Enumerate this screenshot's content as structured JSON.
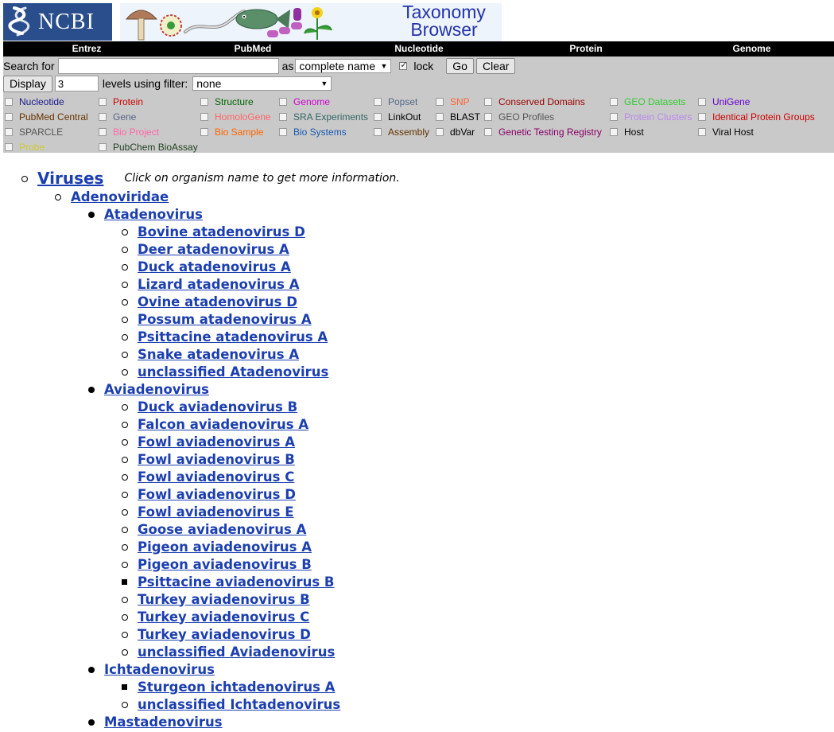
{
  "header": {
    "logo_text": "NCBI",
    "banner_title_line1": "Taxonomy",
    "banner_title_line2": "Browser"
  },
  "nav": [
    "Entrez",
    "PubMed",
    "Nucleotide",
    "Protein",
    "Genome"
  ],
  "search": {
    "label": "Search for",
    "value": "",
    "as_label": "as",
    "name_type": "complete name",
    "lock_label": "lock",
    "lock_checked": true,
    "go_label": "Go",
    "clear_label": "Clear"
  },
  "display": {
    "button_label": "Display",
    "levels_value": "3",
    "levels_label": "levels using filter:",
    "filter_value": "none"
  },
  "filters": [
    {
      "label": "Nucleotide",
      "color": "#1a1a8c"
    },
    {
      "label": "Protein",
      "color": "#cc0000"
    },
    {
      "label": "Structure",
      "color": "#006600"
    },
    {
      "label": "Genome",
      "color": "#cc00cc"
    },
    {
      "label": "Popset",
      "color": "#556688"
    },
    {
      "label": "SNP",
      "color": "#ff6633"
    },
    {
      "label": "Conserved Domains",
      "color": "#990000"
    },
    {
      "label": "GEO Datasets",
      "color": "#33cc33"
    },
    {
      "label": "UniGene",
      "color": "#6600cc"
    },
    {
      "label": "PubMed Central",
      "color": "#663300"
    },
    {
      "label": "Gene",
      "color": "#556688"
    },
    {
      "label": "HomoloGene",
      "color": "#ff6666"
    },
    {
      "label": "SRA Experiments",
      "color": "#336666"
    },
    {
      "label": "LinkOut",
      "color": "#000000"
    },
    {
      "label": "BLAST",
      "color": "#000000"
    },
    {
      "label": "GEO Profiles",
      "color": "#555555"
    },
    {
      "label": "Protein Clusters",
      "color": "#bb88ee"
    },
    {
      "label": "Identical Protein Groups",
      "color": "#cc0000"
    },
    {
      "label": "SPARCLE",
      "color": "#555555"
    },
    {
      "label": "Bio Project",
      "color": "#ff66aa"
    },
    {
      "label": "Bio Sample",
      "color": "#ff6600"
    },
    {
      "label": "Bio Systems",
      "color": "#1a5ab0"
    },
    {
      "label": "Assembly",
      "color": "#663300"
    },
    {
      "label": "dbVar",
      "color": "#000000"
    },
    {
      "label": "Genetic Testing Registry",
      "color": "#880066"
    },
    {
      "label": "Host",
      "color": "#000000"
    },
    {
      "label": "Viral Host",
      "color": "#000000"
    },
    {
      "label": "Probe",
      "color": "#cccc33"
    },
    {
      "label": "PubChem BioAssay",
      "color": "#224422"
    }
  ],
  "tree": {
    "hint": "Click on organism name to get more information.",
    "nodes": [
      {
        "label": "Viruses",
        "bullet": "circle"
      },
      {
        "label": "Adenoviridae",
        "bullet": "circle"
      },
      {
        "label": "Atadenovirus",
        "bullet": "disc"
      },
      {
        "label": "Bovine atadenovirus D",
        "bullet": "circle"
      },
      {
        "label": "Deer atadenovirus A",
        "bullet": "circle"
      },
      {
        "label": "Duck atadenovirus A",
        "bullet": "circle"
      },
      {
        "label": "Lizard atadenovirus A",
        "bullet": "circle"
      },
      {
        "label": "Ovine atadenovirus D",
        "bullet": "circle"
      },
      {
        "label": "Possum atadenovirus A",
        "bullet": "circle"
      },
      {
        "label": "Psittacine atadenovirus A",
        "bullet": "circle"
      },
      {
        "label": "Snake atadenovirus A",
        "bullet": "circle"
      },
      {
        "label": "unclassified Atadenovirus",
        "bullet": "circle"
      },
      {
        "label": "Aviadenovirus",
        "bullet": "disc"
      },
      {
        "label": "Duck aviadenovirus B",
        "bullet": "circle"
      },
      {
        "label": "Falcon aviadenovirus A",
        "bullet": "circle"
      },
      {
        "label": "Fowl aviadenovirus A",
        "bullet": "circle"
      },
      {
        "label": "Fowl aviadenovirus B",
        "bullet": "circle"
      },
      {
        "label": "Fowl aviadenovirus C",
        "bullet": "circle"
      },
      {
        "label": "Fowl aviadenovirus D",
        "bullet": "circle"
      },
      {
        "label": "Fowl aviadenovirus E",
        "bullet": "circle"
      },
      {
        "label": "Goose aviadenovirus A",
        "bullet": "circle"
      },
      {
        "label": "Pigeon aviadenovirus A",
        "bullet": "circle"
      },
      {
        "label": "Pigeon aviadenovirus B",
        "bullet": "circle"
      },
      {
        "label": "Psittacine aviadenovirus B",
        "bullet": "square"
      },
      {
        "label": "Turkey aviadenovirus B",
        "bullet": "circle"
      },
      {
        "label": "Turkey aviadenovirus C",
        "bullet": "circle"
      },
      {
        "label": "Turkey aviadenovirus D",
        "bullet": "circle"
      },
      {
        "label": "unclassified Aviadenovirus",
        "bullet": "circle"
      },
      {
        "label": "Ichtadenovirus",
        "bullet": "disc"
      },
      {
        "label": "Sturgeon ichtadenovirus A",
        "bullet": "square"
      },
      {
        "label": "unclassified Ichtadenovirus",
        "bullet": "circle"
      },
      {
        "label": "Mastadenovirus",
        "bullet": "disc"
      }
    ]
  }
}
